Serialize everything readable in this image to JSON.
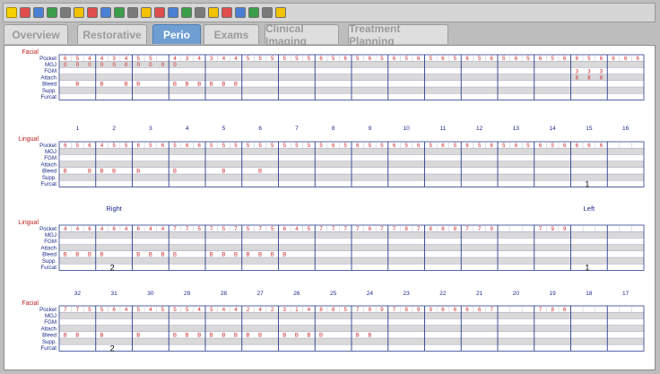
{
  "toolbar": {
    "icons": [
      "help-icon",
      "perio-icon",
      "save-icon",
      "print-icon",
      "grid-icon",
      "grid-icon",
      "grid-icon",
      "book-icon",
      "list-icon",
      "person-icon",
      "report-icon",
      "tooth-icon",
      "arrow-left-icon",
      "arrow-right-icon",
      "square-icon",
      "square-icon",
      "refresh-icon",
      "ring-icon",
      "pencil-icon",
      "undo-icon",
      "settings-icon"
    ]
  },
  "tabs": [
    {
      "label": "Overview",
      "active": false
    },
    {
      "label": "Restorative",
      "active": false
    },
    {
      "label": "Perio",
      "active": true
    },
    {
      "label": "Exams",
      "active": false
    },
    {
      "label": "Clinical Imaging",
      "active": false
    },
    {
      "label": "Treatment Planning",
      "active": false
    }
  ],
  "row_labels": [
    "Pocket",
    "MGJ",
    "FGM",
    "Attach",
    "Bleed",
    "Supp.",
    "Furcat"
  ],
  "sections": [
    {
      "title": "Facial",
      "cells": {
        "Pocket": [
          [
            "6",
            "5",
            "4"
          ],
          [
            "4",
            "3",
            "4"
          ],
          [
            "5",
            "5"
          ],
          [
            "4",
            "3",
            "4"
          ],
          [
            "3",
            "4",
            "4"
          ],
          [
            "5",
            "5",
            "5"
          ],
          [
            "5",
            "5",
            "5"
          ],
          [
            "6",
            "5",
            "6"
          ],
          [
            "5",
            "6",
            "5"
          ],
          [
            "6",
            "5",
            "6"
          ],
          [
            "5",
            "6",
            "5"
          ],
          [
            "6",
            "5",
            "6"
          ],
          [
            "5",
            "6",
            "5"
          ],
          [
            "6",
            "5",
            "6"
          ],
          [
            "6",
            "5",
            "6"
          ],
          [
            "6",
            "6",
            "6"
          ],
          []
        ],
        "MGJ": [
          [
            "0",
            "0",
            "0"
          ],
          [
            "0",
            "0",
            "0"
          ],
          [
            "0",
            "0",
            "0"
          ],
          [
            "0"
          ]
        ],
        "FGM": [
          [],
          [],
          [],
          [],
          [],
          [],
          [],
          [],
          [],
          [],
          [],
          [],
          [],
          [],
          [
            "3",
            "3",
            "3"
          ],
          [],
          []
        ],
        "Attach": [
          [],
          [],
          [],
          [],
          [],
          [],
          [],
          [],
          [],
          [],
          [],
          [],
          [],
          [],
          [
            "8",
            "8",
            "8"
          ],
          [],
          []
        ],
        "Bleed": [
          [
            "",
            "B",
            ""
          ],
          [
            "B",
            "",
            "B"
          ],
          [
            "B",
            "",
            ""
          ],
          [
            "B",
            "B",
            "B"
          ],
          [
            "B",
            "B",
            "B"
          ]
        ],
        "Supp.": [],
        "Furcat": []
      }
    },
    {
      "title": "Lingual",
      "cells": {
        "Pocket": [
          [
            "6",
            "5",
            "6"
          ],
          [
            "4",
            "5",
            "5"
          ],
          [
            "6",
            "5",
            "6"
          ],
          [
            "5",
            "6",
            "6"
          ],
          [
            "5",
            "5",
            "5"
          ],
          [
            "5",
            "5",
            "5"
          ],
          [
            "5",
            "5",
            "5"
          ],
          [
            "5",
            "6",
            "5"
          ],
          [
            "6",
            "5",
            "5"
          ],
          [
            "6",
            "5",
            "6"
          ],
          [
            "5",
            "6",
            "5"
          ],
          [
            "6",
            "5",
            "6"
          ],
          [
            "5",
            "6",
            "5"
          ],
          [
            "6",
            "5",
            "6"
          ],
          [
            "6",
            "6",
            "6"
          ],
          [],
          []
        ],
        "MGJ": [],
        "FGM": [],
        "Attach": [],
        "Bleed": [
          [
            "B",
            "",
            "B"
          ],
          [
            "B",
            "B",
            ""
          ],
          [
            "B",
            "",
            ""
          ],
          [
            "B",
            "",
            ""
          ],
          [
            "",
            "B",
            ""
          ],
          [
            "",
            "B",
            ""
          ]
        ],
        "Supp.": [],
        "Furcat": [
          "1"
        ]
      }
    },
    {
      "title": "Lingual",
      "cells": {
        "Pocket": [
          [
            "4",
            "4",
            "6"
          ],
          [
            "4",
            "6",
            "4"
          ],
          [
            "6",
            "4",
            "4"
          ],
          [
            "7",
            "7",
            "5"
          ],
          [
            "7",
            "5",
            "7"
          ],
          [
            "5",
            "7",
            "5"
          ],
          [
            "6",
            "4",
            "5"
          ],
          [
            "7",
            "7",
            "7"
          ],
          [
            "7",
            "6",
            "7"
          ],
          [
            "7",
            "8",
            "7"
          ],
          [
            "8",
            "8",
            "8"
          ],
          [
            "7",
            "7",
            "9"
          ],
          [],
          [
            "7",
            "9",
            "9"
          ],
          []
        ],
        "Bleed": [
          [
            "B",
            "B",
            "B"
          ],
          [
            "B"
          ],
          [
            "B",
            "B",
            "B"
          ],
          [
            "B"
          ],
          [
            "B",
            "B",
            "B"
          ],
          [
            "B",
            "B",
            "B"
          ],
          [
            "B"
          ]
        ],
        "Furcat": [
          "2",
          "1"
        ]
      }
    },
    {
      "title": "Facial",
      "cells": {
        "Pocket": [
          [
            "7",
            "7",
            "5"
          ],
          [
            "5",
            "6",
            "4"
          ],
          [
            "5",
            "4",
            "5"
          ],
          [
            "5",
            "5",
            "4"
          ],
          [
            "5",
            "4",
            "4"
          ],
          [
            "2",
            "4",
            "2"
          ],
          [
            "3",
            "1",
            "4"
          ],
          [
            "8",
            "8",
            "5"
          ],
          [
            "7",
            "9",
            "9"
          ],
          [
            "7",
            "8",
            "9"
          ],
          [
            "9",
            "6",
            "6"
          ],
          [
            "6",
            "6",
            "7"
          ],
          [],
          [
            "7",
            "8",
            "6"
          ],
          []
        ],
        "Bleed": [
          [
            "B",
            "B"
          ],
          [
            "B"
          ],
          [
            "B"
          ],
          [
            "B",
            "B",
            "B"
          ],
          [
            "B",
            "B",
            "B"
          ],
          [
            "B",
            "B"
          ],
          [
            "B",
            "B",
            "B"
          ],
          [
            "B"
          ],
          [
            "B",
            "B"
          ]
        ],
        "Furcat": [
          "2"
        ]
      }
    }
  ],
  "labels": {
    "upper_numbers": [
      "1",
      "2",
      "3",
      "4",
      "5",
      "6",
      "7",
      "8",
      "9",
      "10",
      "11",
      "12",
      "13",
      "14",
      "15",
      "16"
    ],
    "lower_numbers": [
      "32",
      "31",
      "30",
      "29",
      "28",
      "27",
      "26",
      "25",
      "24",
      "23",
      "22",
      "21",
      "20",
      "19",
      "18",
      "17"
    ],
    "right_label": "Right",
    "left_label": "Left"
  },
  "colors": {
    "value_red": "#cc2222",
    "bleed_red": "#cc2222",
    "grid_blue": "#2b3f8f",
    "section_title": "#c02020",
    "row_gray": "#d9d9d9"
  }
}
